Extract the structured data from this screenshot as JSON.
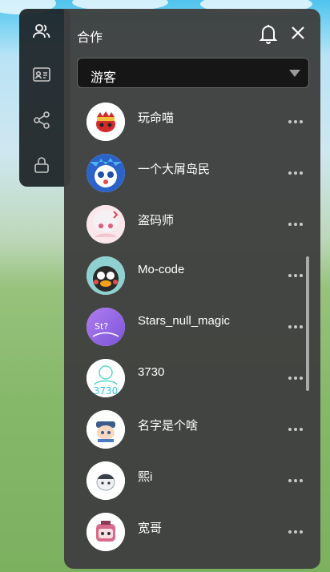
{
  "panel": {
    "title": "合作",
    "filter_selected": "游客"
  },
  "rail": {
    "items": [
      {
        "icon": "friends-icon"
      },
      {
        "icon": "id-card-icon"
      },
      {
        "icon": "share-icon"
      },
      {
        "icon": "lock-icon"
      }
    ]
  },
  "header_icons": [
    "bell-icon",
    "close-icon"
  ],
  "friends": [
    {
      "name": "玩命喵"
    },
    {
      "name": "一个大屑岛民"
    },
    {
      "name": "盗码师"
    },
    {
      "name": "Mo-code"
    },
    {
      "name": "Stars_null_magic"
    },
    {
      "name": "3730",
      "avatar_text": "3730"
    },
    {
      "name": "名字是个啥"
    },
    {
      "name": "熙i"
    },
    {
      "name": "宽哥"
    }
  ],
  "colors": {
    "panel_bg": "#3e403e",
    "rail_bg": "#1c2226",
    "text": "#ffffff"
  }
}
